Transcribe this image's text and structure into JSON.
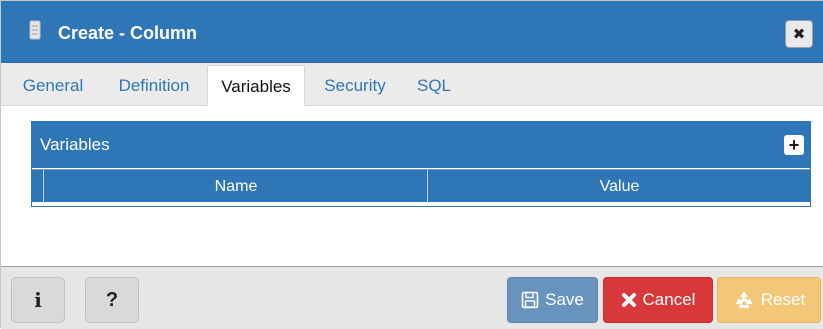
{
  "dialog": {
    "title": "Create - Column",
    "close_symbol": "✖"
  },
  "tabs": [
    {
      "label": "General",
      "active": false
    },
    {
      "label": "Definition",
      "active": false
    },
    {
      "label": "Variables",
      "active": true
    },
    {
      "label": "Security",
      "active": false
    },
    {
      "label": "SQL",
      "active": false
    }
  ],
  "variables_panel": {
    "title": "Variables",
    "add_symbol": "+",
    "columns": [
      "Name",
      "Value"
    ],
    "rows": []
  },
  "footer": {
    "info_symbol": "i",
    "help_symbol": "?",
    "save_label": "Save",
    "cancel_label": "Cancel",
    "reset_label": "Reset"
  },
  "icons": {
    "title": "database-icon",
    "close": "close-icon",
    "add": "plus-icon",
    "info": "info-icon",
    "help": "question-icon",
    "save": "floppy-disk-icon",
    "cancel": "x-icon",
    "reset": "recycle-icon"
  },
  "colors": {
    "primary": "#2f76b7",
    "save": "#6893bd",
    "cancel": "#d9383a",
    "reset": "#f2c778"
  }
}
